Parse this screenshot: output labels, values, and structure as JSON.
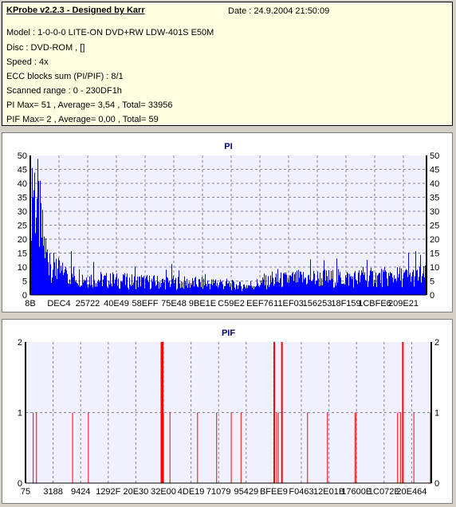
{
  "info": {
    "title": "KProbe v2.2.3 - Designed by Karr",
    "date": "Date : 24.9.2004 21:50:09",
    "model": "Model : 1-0-0-0 LITE-ON DVD+RW LDW-401S  E50M",
    "disc": "Disc : DVD-ROM ,  []",
    "speed": "Speed : 4x",
    "ecc": "ECC blocks sum (PI/PIF) : 8/1",
    "range": "Scanned range : 0 - 230DF1h",
    "pi_stats": "PI Max= 51 , Average= 3,54 , Total= 33956",
    "pif_stats": "PIF Max= 2 , Average= 0,00 , Total= 59"
  },
  "colors": {
    "bar": "#0000ff",
    "pif_bar": "#ff0000",
    "plot_bg": "#f0f0ff",
    "title": "#000080"
  },
  "chart_data": [
    {
      "type": "bar",
      "title": "PI",
      "ylim": [
        0,
        50
      ],
      "yticks": [
        0,
        5,
        10,
        15,
        20,
        25,
        30,
        35,
        40,
        45,
        50
      ],
      "xticks": [
        "8B",
        "DEC4",
        "25722",
        "40E49",
        "58EFF",
        "75E48",
        "9BE1E",
        "C59E2",
        "EEF76",
        "11EF03",
        "156253",
        "18F159",
        "1CBFE6",
        "209E21"
      ],
      "grid": true,
      "profile": [
        [
          0,
          41
        ],
        [
          0.3,
          51
        ],
        [
          1,
          45
        ],
        [
          2,
          35
        ],
        [
          3,
          24
        ],
        [
          4,
          17
        ],
        [
          5,
          13
        ],
        [
          6,
          11
        ],
        [
          8,
          9
        ],
        [
          10,
          8.5
        ],
        [
          12,
          8
        ],
        [
          15,
          7
        ],
        [
          20,
          6
        ],
        [
          30,
          5.5
        ],
        [
          40,
          5
        ],
        [
          50,
          4.5
        ],
        [
          52,
          3.5
        ],
        [
          55,
          4
        ],
        [
          60,
          5.5
        ],
        [
          65,
          6.5
        ],
        [
          70,
          7
        ],
        [
          80,
          7
        ],
        [
          90,
          7.5
        ],
        [
          100,
          8
        ]
      ]
    },
    {
      "type": "bar",
      "title": "PIF",
      "ylim": [
        0,
        2
      ],
      "yticks": [
        0,
        1,
        2
      ],
      "xticks": [
        "75",
        "3188",
        "9424",
        "1292F",
        "20E30",
        "32E00",
        "4DE19",
        "71079",
        "95429",
        "BFEE9",
        "F0463",
        "12E01B",
        "17600E",
        "1C072E",
        "20E464"
      ],
      "grid": true,
      "points": [
        [
          1.8,
          1
        ],
        [
          2.6,
          1
        ],
        [
          11.5,
          1
        ],
        [
          15.4,
          1
        ],
        [
          33.3,
          2
        ],
        [
          33.6,
          2
        ],
        [
          33.9,
          1
        ],
        [
          35.5,
          1
        ],
        [
          42.3,
          1
        ],
        [
          47.0,
          1
        ],
        [
          50.6,
          1
        ],
        [
          53.0,
          1
        ],
        [
          61.1,
          2
        ],
        [
          61.8,
          1
        ],
        [
          62.2,
          1
        ],
        [
          63.0,
          2
        ],
        [
          69.4,
          1
        ],
        [
          74.3,
          1
        ],
        [
          81.1,
          1
        ],
        [
          81.4,
          1
        ],
        [
          91.6,
          1
        ],
        [
          92.3,
          1
        ],
        [
          92.8,
          2
        ],
        [
          95.6,
          1
        ],
        [
          99.7,
          1
        ]
      ]
    }
  ]
}
